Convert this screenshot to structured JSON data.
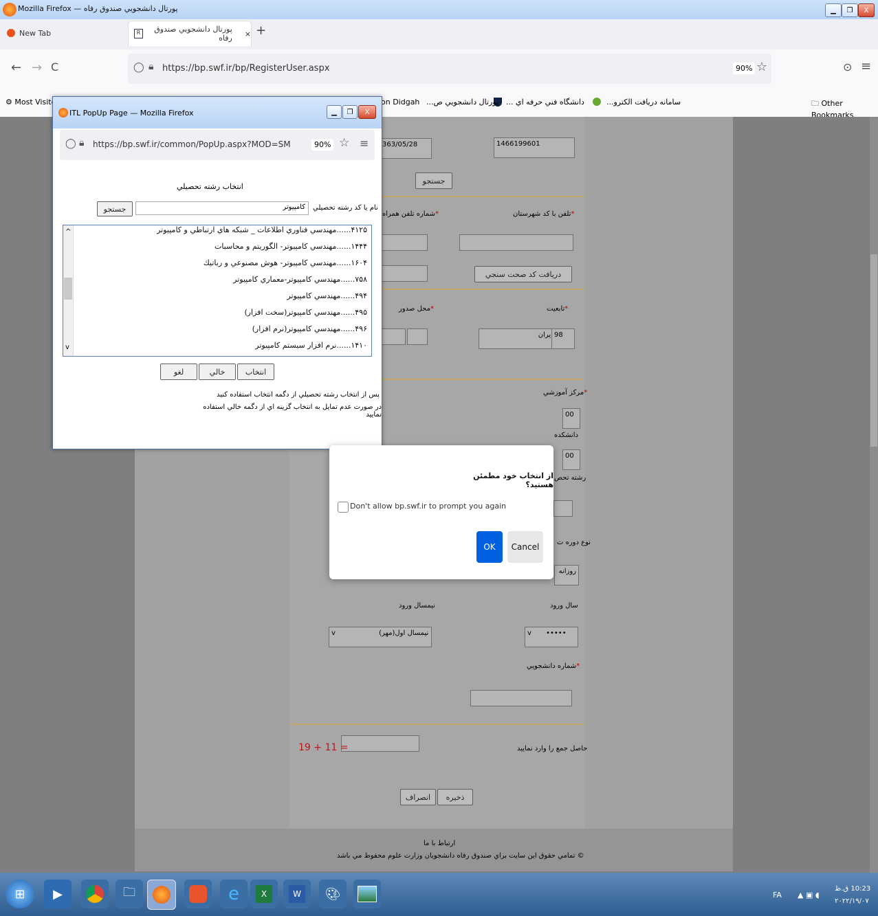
{
  "os_window": {
    "title": "پورتال دانشجويي صندوق رفاه — Mozilla Firefox",
    "minimize": "▁",
    "maximize": "❐",
    "close": "X"
  },
  "tabs": [
    {
      "label": "New Tab"
    },
    {
      "label": "پورتال دانشجويي صندوق رفاه",
      "close": "×"
    }
  ],
  "new_tab": "+",
  "nav": {
    "back": "←",
    "forward": "→",
    "reload": "C",
    "url": "https://bp.swf.ir/bp/RegisterUser.aspx",
    "zoom": "90%",
    "star": "☆",
    "pocket": "⊙",
    "menu": "≡"
  },
  "bookmarks": {
    "most_visited": "Most Visite",
    "items": [
      "سامانه دريافت الكترو...",
      "دانشگاه فني حرفه اي ...",
      "پورتال دانشجويي ص...",
      "on Didgah"
    ],
    "other": "Other Bookmarks"
  },
  "form": {
    "national_code": "1466199601",
    "birth_date": "363/05/28",
    "search_btn": "جستجو",
    "phone_city_label": "تلفن با كد شهرستان",
    "mobile_label": "شماره تلفن همراه",
    "get_code_btn": "دريافت كد صحت سنجي",
    "nationality_label": "تابعيت",
    "issue_place_label": "محل صدور",
    "nationality_code": "98",
    "nationality_value": "ايران",
    "edu_center_label": "مركز آموزشي",
    "edu_center_code": "00",
    "faculty_label": "دانشكده",
    "faculty_code": "00",
    "field_label": "رشته تحص",
    "course_type_label": "نوع دوره ت",
    "course_type_value": "روزانه",
    "entry_year_label": "سال ورود",
    "entry_year_value": "•••••",
    "entry_semester_label": "نيمسال ورود",
    "entry_semester_value": "نيمسال اول(مهر)",
    "student_no_label": "شماره دانشجويي",
    "captcha_label": "حاصل جمع را وارد نماييد",
    "captcha_expr": "19 + 11 =",
    "save_btn": "ذخيره",
    "cancel_btn": "انصراف",
    "footer_contact": "ارتباط با ما",
    "footer_copyright": "© تمامي حقوق اين سايت براي صندوق رفاه دانشجويان وزارت علوم محفوظ مي باشد"
  },
  "popup": {
    "title": "ITL PopUp Page — Mozilla Firefox",
    "url": "https://bp.swf.ir/common/PopUp.aspx?MOD=SM",
    "zoom": "90%",
    "heading": "انتخاب رشته تحصيلي",
    "search_label": "نام يا كد رشته تحصيلي",
    "search_value": "كامپيوتر",
    "search_btn": "جستجو",
    "list": [
      "۴۱۲۵......مهندسي فناوري اطلاعات _ شبكه هاي ارتباطي و كامپيوتر",
      "۱۴۴۴......مهندسي كامپيوتر- الگوريتم و محاسبات",
      "۱۶۰۴......مهندسي كامپيوتر- هوش مصنوعي و رباتيك",
      "۷۵۸......مهندسي كامپيوتر-معماري كامپيوتر",
      "۴۹۴......مهندسي كامپيوتر",
      "۴۹۵......مهندسي كامپيوتر(سخت افزار)",
      "۴۹۶......مهندسي كامپيوتر(نرم افزار)",
      "۱۴۱۰......نرم افزار سيستم كامپيوتر"
    ],
    "select_btn": "انتخاب",
    "empty_btn": "خالي",
    "cancel_btn": "لغو",
    "hint1": "پس از انتخاب رشته تحصيلي از دگمه انتخاب استفاده كنيد",
    "hint2": "در صورت عدم تمايل به انتخاب گزينه اي از دگمه خالي استفاده نماييد"
  },
  "dialog": {
    "message": "از انتخاب خود مطمئن هستيد؟",
    "checkbox_label": "Don't allow bp.swf.ir to prompt you again",
    "ok": "OK",
    "cancel": "Cancel"
  },
  "taskbar": {
    "lang": "FA",
    "time": "10:23 ق.ظ",
    "date": "۲۰۲۲/۱۹/۰۷"
  }
}
